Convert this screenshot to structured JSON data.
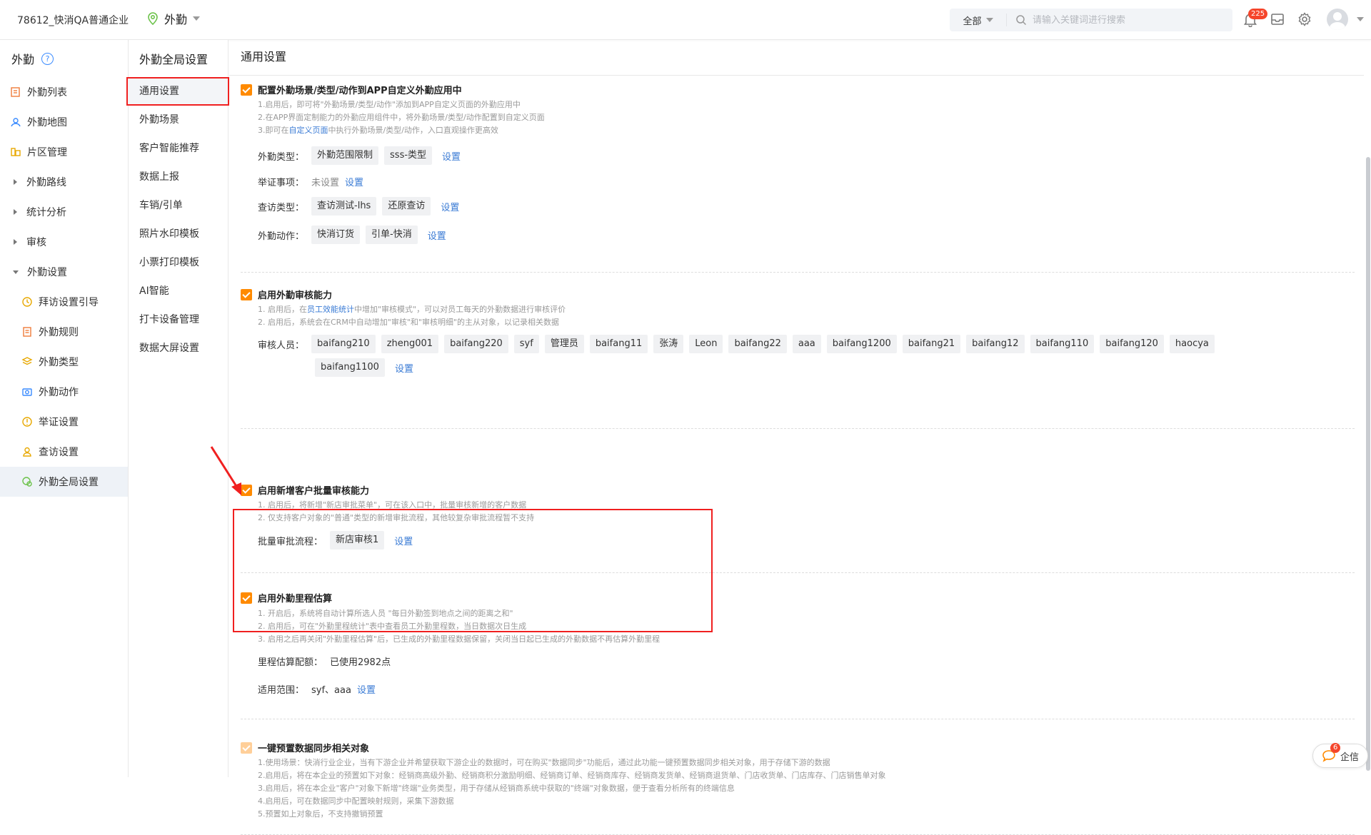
{
  "topbar": {
    "company": "78612_快消QA普通企业",
    "app_name": "外勤",
    "search_scope": "全部",
    "search_placeholder": "请输入关键词进行搜索",
    "notification_count": "225"
  },
  "leftnav": {
    "title": "外勤",
    "items": [
      {
        "label": "外勤列表"
      },
      {
        "label": "外勤地图"
      },
      {
        "label": "片区管理"
      },
      {
        "label": "外勤路线"
      },
      {
        "label": "统计分析"
      },
      {
        "label": "审核"
      },
      {
        "label": "外勤设置"
      },
      {
        "label": "拜访设置引导"
      },
      {
        "label": "外勤规则"
      },
      {
        "label": "外勤类型"
      },
      {
        "label": "外勤动作"
      },
      {
        "label": "举证设置"
      },
      {
        "label": "查访设置"
      },
      {
        "label": "外勤全局设置"
      }
    ]
  },
  "midnav": {
    "title": "外勤全局设置",
    "items": [
      "通用设置",
      "外勤场景",
      "客户智能推荐",
      "数据上报",
      "车销/引单",
      "照片水印模板",
      "小票打印模板",
      "AI智能",
      "打卡设备管理",
      "数据大屏设置"
    ]
  },
  "main": {
    "header": "通用设置",
    "set_label": "设置",
    "s1": {
      "title": "配置外勤场景/类型/动作到APP自定义外勤应用中",
      "desc1": "1.启用后，即可将\"外勤场景/类型/动作\"添加到APP自定义页面的外勤应用中",
      "desc2": "2.在APP界面定制能力的外勤应用组件中，将外勤场景/类型/动作配置到自定义页面",
      "desc3_pre": "3.即可在",
      "desc3_link": "自定义页面",
      "desc3_post": "中执行外勤场景/类型/动作，入口直观操作更高效",
      "type_label": "外勤类型：",
      "type_tags": [
        "外勤范围限制",
        "sss-类型"
      ],
      "evidence_label": "举证事项：",
      "evidence_value": "未设置",
      "visit_label": "查访类型：",
      "visit_tags": [
        "查访测试-lhs",
        "还原查访"
      ],
      "action_label": "外勤动作：",
      "action_tags": [
        "快消订货",
        "引单-快消"
      ]
    },
    "s2": {
      "title": "启用外勤审核能力",
      "desc1_pre": "1. 启用后，在",
      "desc1_link": "员工效能统计",
      "desc1_post": "中增加\"审核模式\"，可以对员工每天的外勤数据进行审核评价",
      "desc2": "2. 启用后，系统会在CRM中自动增加\"审核\"和\"审核明细\"的主从对象，以记录相关数据",
      "reviewer_label": "审核人员：",
      "reviewers": [
        "baifang210",
        "zheng001",
        "baifang220",
        "syf",
        "管理员",
        "baifang11",
        "张涛",
        "Leon",
        "baifang22",
        "aaa",
        "baifang1200",
        "baifang21",
        "baifang12",
        "baifang110",
        "baifang120",
        "haocya",
        "baifang1100"
      ]
    },
    "s3": {
      "title": "启用新增客户批量审核能力",
      "desc1": "1. 启用后，将新增\"新店审批菜单\"，可在该入口中，批量审核新增的客户数据",
      "desc2": "2. 仅支持客户对象的\"普通\"类型的新增审批流程，其他较复杂审批流程暂不支持",
      "flow_label": "批量审批流程：",
      "flow_tag": "新店审核1"
    },
    "s4": {
      "title": "启用外勤里程估算",
      "desc1": "1. 开启后，系统将自动计算所选人员 \"每日外勤签到地点之间的距离之和\"",
      "desc2": "2. 启用后，可在\"外勤里程统计\"表中查看员工外勤里程数，当日数据次日生成",
      "desc3": "3. 启用之后再关闭\"外勤里程估算\"后，已生成的外勤里程数据保留，关闭当日起已生成的外勤数据不再估算外勤里程",
      "quota_label": "里程估算配额：",
      "quota_value": "已使用2982点",
      "scope_label": "适用范围：",
      "scope_value": "syf、aaa"
    },
    "s5": {
      "title": "一键预置数据同步相关对象",
      "desc1": "1.使用场景：快消行业企业，当有下游企业并希望获取下游企业的数据时，可在购买\"数据同步\"功能后，通过此功能一键预置数据同步相关对象，用于存储下游的数据",
      "desc2": "2.启用后，将在本企业的预置如下对象：经销商高级外勤、经销商积分激励明细、经销商订单、经销商库存、经销商发货单、经销商退货单、门店收货单、门店库存、门店销售单对象",
      "desc3": "3.启用后，将在本企业\"客户\"对象下新增\"终端\"业务类型，用于存储从经销商系统中获取的\"终端\"对象数据，便于查看分析所有的终端信息",
      "desc4": "4.启用后，可在数据同步中配置映射规则，采集下游数据",
      "desc5": "5.预置如上对象后，不支持撤销预置"
    }
  },
  "qixin": {
    "label": "企信",
    "count": "6"
  },
  "colors": {
    "accent": "#ff8a00",
    "link": "#3a7bd5",
    "highlight": "#f02020"
  }
}
